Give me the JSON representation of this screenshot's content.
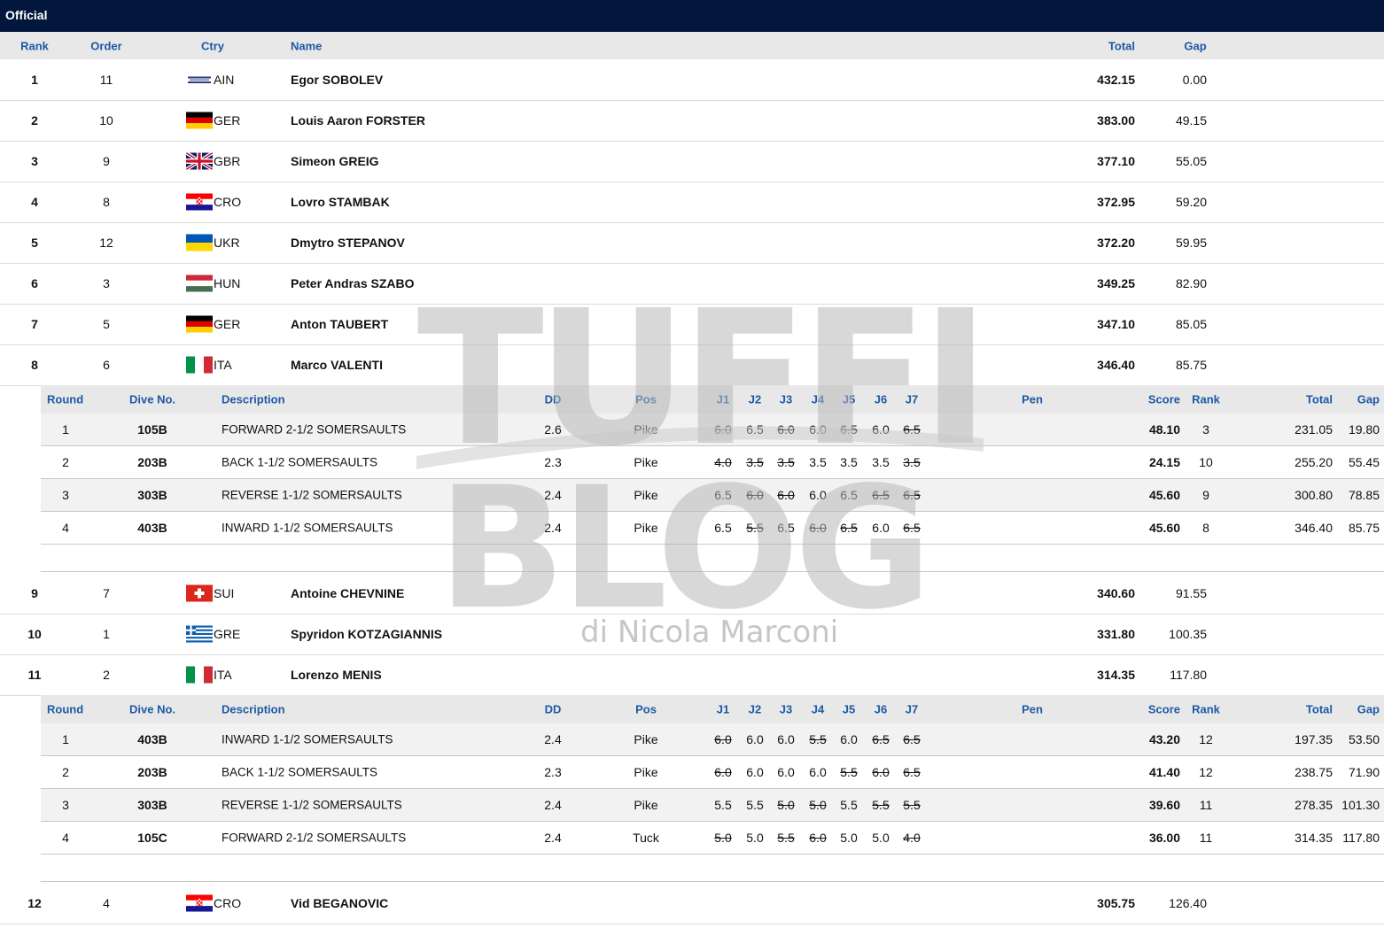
{
  "status": "Official",
  "columns": {
    "rank": "Rank",
    "order": "Order",
    "country": "Ctry",
    "name": "Name",
    "total": "Total",
    "gap": "Gap"
  },
  "detail_columns": {
    "round": "Round",
    "dive_no": "Dive No.",
    "description": "Description",
    "dd": "DD",
    "pos": "Pos",
    "judges": [
      "J1",
      "J2",
      "J3",
      "J4",
      "J5",
      "J6",
      "J7"
    ],
    "pen": "Pen",
    "score": "Score",
    "rank": "Rank",
    "total": "Total",
    "gap": "Gap"
  },
  "athletes": [
    {
      "rank": "1",
      "order": "11",
      "country": "AIN",
      "flag": "ain",
      "name": "Egor SOBOLEV",
      "total": "432.15",
      "gap": "0.00"
    },
    {
      "rank": "2",
      "order": "10",
      "country": "GER",
      "flag": "ger",
      "name": "Louis Aaron FORSTER",
      "total": "383.00",
      "gap": "49.15"
    },
    {
      "rank": "3",
      "order": "9",
      "country": "GBR",
      "flag": "gbr",
      "name": "Simeon GREIG",
      "total": "377.10",
      "gap": "55.05"
    },
    {
      "rank": "4",
      "order": "8",
      "country": "CRO",
      "flag": "cro",
      "name": "Lovro STAMBAK",
      "total": "372.95",
      "gap": "59.20"
    },
    {
      "rank": "5",
      "order": "12",
      "country": "UKR",
      "flag": "ukr",
      "name": "Dmytro STEPANOV",
      "total": "372.20",
      "gap": "59.95"
    },
    {
      "rank": "6",
      "order": "3",
      "country": "HUN",
      "flag": "hun",
      "name": "Peter Andras SZABO",
      "total": "349.25",
      "gap": "82.90"
    },
    {
      "rank": "7",
      "order": "5",
      "country": "GER",
      "flag": "ger",
      "name": "Anton TAUBERT",
      "total": "347.10",
      "gap": "85.05"
    },
    {
      "rank": "8",
      "order": "6",
      "country": "ITA",
      "flag": "ita",
      "name": "Marco VALENTI",
      "total": "346.40",
      "gap": "85.75",
      "dives": [
        {
          "round": "1",
          "dive_no": "105B",
          "description": "FORWARD 2-1/2 SOMERSAULTS",
          "dd": "2.6",
          "pos": "Pike",
          "judges": [
            [
              "6.0",
              true
            ],
            [
              "6.5",
              false
            ],
            [
              "6.0",
              true
            ],
            [
              "6.0",
              false
            ],
            [
              "6.5",
              true
            ],
            [
              "6.0",
              false
            ],
            [
              "6.5",
              true
            ]
          ],
          "pen": "",
          "score": "48.10",
          "rank": "3",
          "total": "231.05",
          "gap": "19.80"
        },
        {
          "round": "2",
          "dive_no": "203B",
          "description": "BACK 1-1/2 SOMERSAULTS",
          "dd": "2.3",
          "pos": "Pike",
          "judges": [
            [
              "4.0",
              true
            ],
            [
              "3.5",
              true
            ],
            [
              "3.5",
              true
            ],
            [
              "3.5",
              false
            ],
            [
              "3.5",
              false
            ],
            [
              "3.5",
              false
            ],
            [
              "3.5",
              true
            ]
          ],
          "pen": "",
          "score": "24.15",
          "rank": "10",
          "total": "255.20",
          "gap": "55.45"
        },
        {
          "round": "3",
          "dive_no": "303B",
          "description": "REVERSE 1-1/2 SOMERSAULTS",
          "dd": "2.4",
          "pos": "Pike",
          "judges": [
            [
              "6.5",
              false
            ],
            [
              "6.0",
              true
            ],
            [
              "6.0",
              true
            ],
            [
              "6.0",
              false
            ],
            [
              "6.5",
              false
            ],
            [
              "6.5",
              true
            ],
            [
              "6.5",
              true
            ]
          ],
          "pen": "",
          "score": "45.60",
          "rank": "9",
          "total": "300.80",
          "gap": "78.85"
        },
        {
          "round": "4",
          "dive_no": "403B",
          "description": "INWARD 1-1/2 SOMERSAULTS",
          "dd": "2.4",
          "pos": "Pike",
          "judges": [
            [
              "6.5",
              false
            ],
            [
              "5.5",
              true
            ],
            [
              "6.5",
              false
            ],
            [
              "6.0",
              true
            ],
            [
              "6.5",
              true
            ],
            [
              "6.0",
              false
            ],
            [
              "6.5",
              true
            ]
          ],
          "pen": "",
          "score": "45.60",
          "rank": "8",
          "total": "346.40",
          "gap": "85.75"
        }
      ]
    },
    {
      "rank": "9",
      "order": "7",
      "country": "SUI",
      "flag": "sui",
      "name": "Antoine CHEVNINE",
      "total": "340.60",
      "gap": "91.55"
    },
    {
      "rank": "10",
      "order": "1",
      "country": "GRE",
      "flag": "gre",
      "name": "Spyridon KOTZAGIANNIS",
      "total": "331.80",
      "gap": "100.35"
    },
    {
      "rank": "11",
      "order": "2",
      "country": "ITA",
      "flag": "ita",
      "name": "Lorenzo MENIS",
      "total": "314.35",
      "gap": "117.80",
      "dives": [
        {
          "round": "1",
          "dive_no": "403B",
          "description": "INWARD 1-1/2 SOMERSAULTS",
          "dd": "2.4",
          "pos": "Pike",
          "judges": [
            [
              "6.0",
              true
            ],
            [
              "6.0",
              false
            ],
            [
              "6.0",
              false
            ],
            [
              "5.5",
              true
            ],
            [
              "6.0",
              false
            ],
            [
              "6.5",
              true
            ],
            [
              "6.5",
              true
            ]
          ],
          "pen": "",
          "score": "43.20",
          "rank": "12",
          "total": "197.35",
          "gap": "53.50"
        },
        {
          "round": "2",
          "dive_no": "203B",
          "description": "BACK 1-1/2 SOMERSAULTS",
          "dd": "2.3",
          "pos": "Pike",
          "judges": [
            [
              "6.0",
              true
            ],
            [
              "6.0",
              false
            ],
            [
              "6.0",
              false
            ],
            [
              "6.0",
              false
            ],
            [
              "5.5",
              true
            ],
            [
              "6.0",
              true
            ],
            [
              "6.5",
              true
            ]
          ],
          "pen": "",
          "score": "41.40",
          "rank": "12",
          "total": "238.75",
          "gap": "71.90"
        },
        {
          "round": "3",
          "dive_no": "303B",
          "description": "REVERSE 1-1/2 SOMERSAULTS",
          "dd": "2.4",
          "pos": "Pike",
          "judges": [
            [
              "5.5",
              false
            ],
            [
              "5.5",
              false
            ],
            [
              "5.0",
              true
            ],
            [
              "5.0",
              true
            ],
            [
              "5.5",
              false
            ],
            [
              "5.5",
              true
            ],
            [
              "5.5",
              true
            ]
          ],
          "pen": "",
          "score": "39.60",
          "rank": "11",
          "total": "278.35",
          "gap": "101.30"
        },
        {
          "round": "4",
          "dive_no": "105C",
          "description": "FORWARD 2-1/2 SOMERSAULTS",
          "dd": "2.4",
          "pos": "Tuck",
          "judges": [
            [
              "5.0",
              true
            ],
            [
              "5.0",
              false
            ],
            [
              "5.5",
              true
            ],
            [
              "6.0",
              true
            ],
            [
              "5.0",
              false
            ],
            [
              "5.0",
              false
            ],
            [
              "4.0",
              true
            ]
          ],
          "pen": "",
          "score": "36.00",
          "rank": "11",
          "total": "314.35",
          "gap": "117.80"
        }
      ]
    },
    {
      "rank": "12",
      "order": "4",
      "country": "CRO",
      "flag": "cro",
      "name": "Vid BEGANOVIC",
      "total": "305.75",
      "gap": "126.40"
    }
  ],
  "watermark": {
    "line1": "TUFFI",
    "line2": "BLOG",
    "sub": "di Nicola Marconi"
  },
  "colors": {
    "header_bar": "#02173b",
    "column_header_text": "#1d5aa5",
    "row_shade": "#f2f2f2"
  }
}
